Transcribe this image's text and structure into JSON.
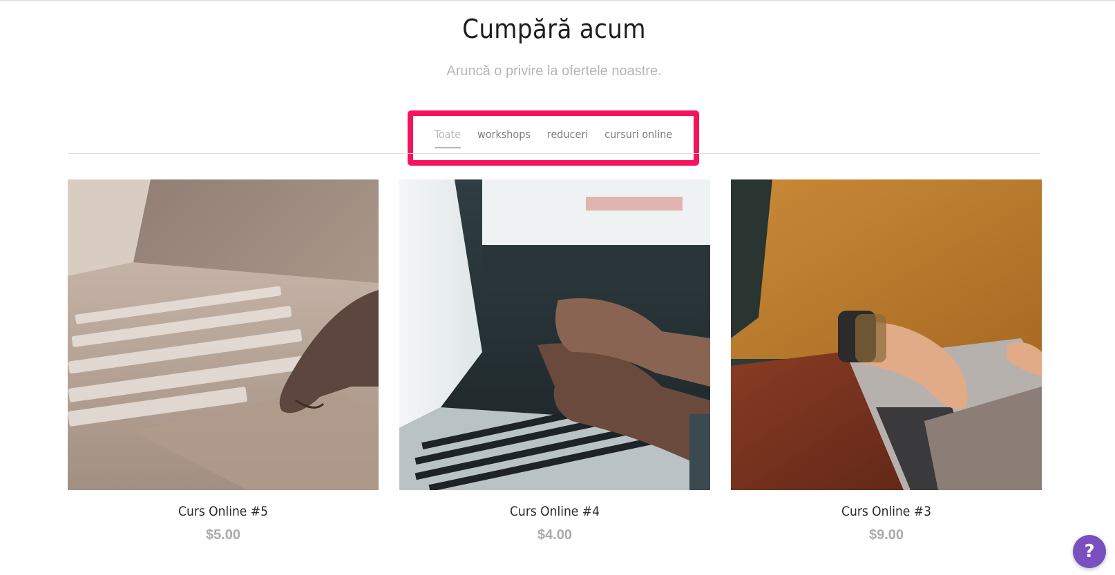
{
  "header": {
    "title": "Cumpără acum",
    "subtitle": "Aruncă o privire la ofertele noastre."
  },
  "filters": {
    "tabs": [
      {
        "label": "Toate",
        "active": true
      },
      {
        "label": "workshops",
        "active": false
      },
      {
        "label": "reduceri",
        "active": false
      },
      {
        "label": "cursuri online",
        "active": false
      }
    ],
    "highlight_color": "#f5145c"
  },
  "products": [
    {
      "name": "Curs Online #5",
      "price": "$5.00",
      "image": "laptop-touchpad-photo"
    },
    {
      "name": "Curs Online #4",
      "price": "$4.00",
      "image": "laptop-typing-photo"
    },
    {
      "name": "Curs Online #3",
      "price": "$9.00",
      "image": "woman-laptop-photo"
    }
  ],
  "help": {
    "label": "?",
    "color": "#7a4fc0"
  }
}
